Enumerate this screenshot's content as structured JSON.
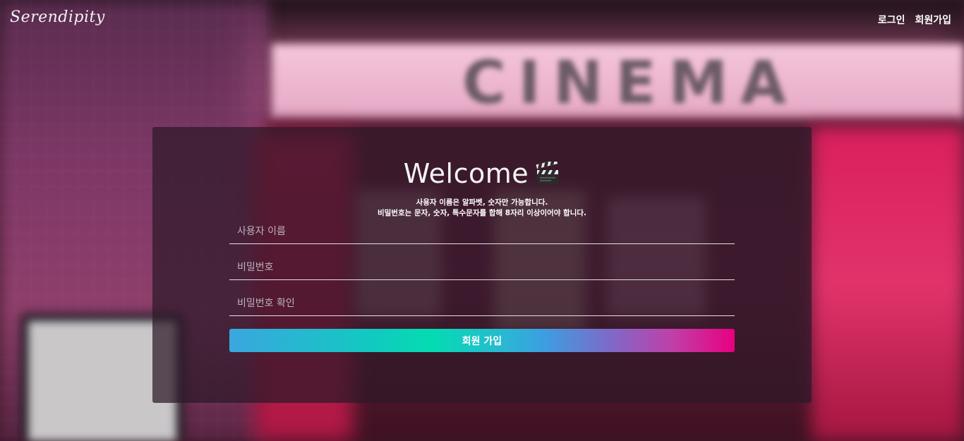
{
  "nav": {
    "logo": "Serendipity",
    "login_label": "로그인",
    "signup_label": "회원가입"
  },
  "background": {
    "sign_text": "CINEMA"
  },
  "form": {
    "title": "Welcome",
    "title_icon": "clapperboard-icon",
    "rule_line1": "사용자 이름은 알파벳, 숫자만 가능합니다.",
    "rule_line2": "비밀번호는 문자, 숫자, 특수문자를 합해 8자리 이상이어야 합니다.",
    "username_placeholder": "사용자 이름",
    "password_placeholder": "비밀번호",
    "confirm_placeholder": "비밀번호 확인",
    "submit_label": "회원 가입"
  },
  "colors": {
    "button_gradient_start": "#3aa7df",
    "button_gradient_mid": "#04dcb2",
    "button_gradient_end": "#e8007f",
    "card_background": "#2d1928"
  }
}
